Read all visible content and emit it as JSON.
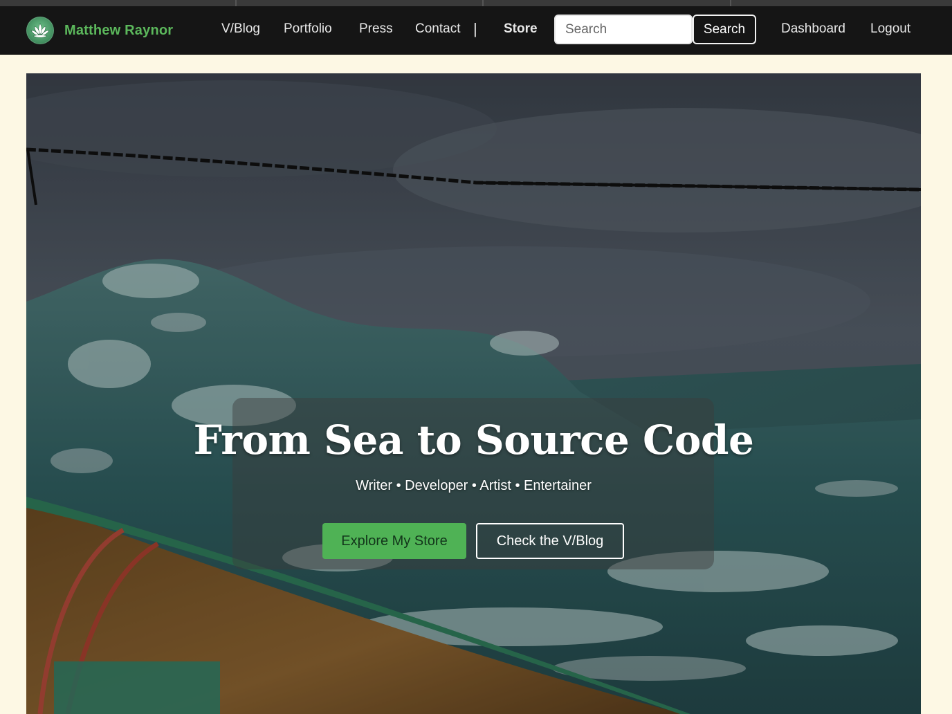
{
  "brand": {
    "name": "Matthew Raynor",
    "logo_icon": "lotus-icon",
    "accent_color": "#5cb85c"
  },
  "nav": {
    "links": [
      {
        "label": "V/Blog"
      },
      {
        "label": "Portfolio"
      },
      {
        "label": "Press"
      },
      {
        "label": "Contact"
      }
    ],
    "separator": "|",
    "store_label": "Store",
    "search": {
      "placeholder": "Search",
      "value": "",
      "button_label": "Search"
    },
    "dashboard_label": "Dashboard",
    "logout_label": "Logout"
  },
  "hero": {
    "title": "From Sea to Source Code",
    "subtitle": "Writer • Developer • Artist • Entertainer",
    "primary_button": "Explore My Store",
    "secondary_button": "Check the V/Blog",
    "primary_color": "#4fb255"
  }
}
